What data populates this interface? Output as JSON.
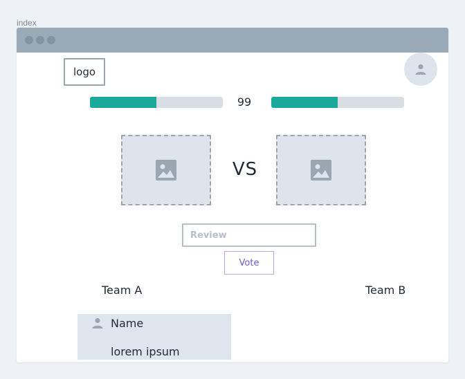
{
  "page": {
    "label": "index"
  },
  "header": {
    "logo_text": "logo"
  },
  "battle": {
    "score": "99",
    "left_progress": 0.5,
    "right_progress": 0.5,
    "vs_text": "VS"
  },
  "review": {
    "placeholder": "Review",
    "value": ""
  },
  "vote": {
    "label": "Vote"
  },
  "teams": {
    "a": "Team A",
    "b": "Team B"
  },
  "comment": {
    "name": "Name",
    "text": "lorem ipsum"
  },
  "colors": {
    "progress_fill": "#1aa99a",
    "progress_track": "#d9dee5",
    "vote_accent": "#6f5bd6",
    "titlebar": "#9aaab7"
  },
  "icons": {
    "avatar": "user-icon",
    "image_placeholder": "image-icon"
  }
}
